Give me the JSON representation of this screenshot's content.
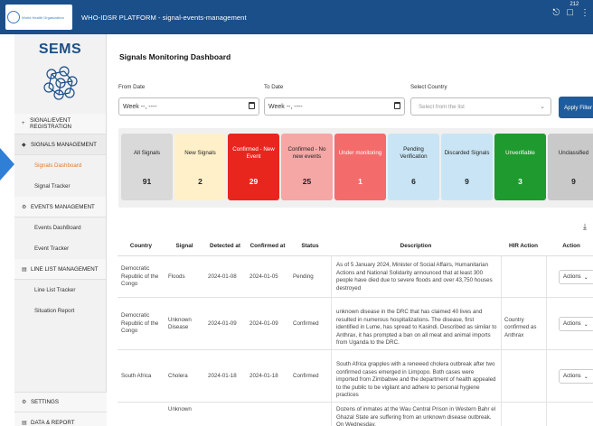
{
  "topbar": {
    "logo_text": "World Health Organization",
    "title": "WHO-IDSR PLATFORM - signal-events-management",
    "notification_count": "212"
  },
  "sidebar": {
    "brand": "SEMS",
    "signal_event_registration": "SIGNAL/EVENT REGISTRATION",
    "signals_management": "SIGNALS MANAGEMENT",
    "signals_dashboard": "Signals Dashboard",
    "signal_tracker": "Signal Tracker",
    "events_management": "EVENTS MANAGEMENT",
    "events_dashboard": "Events DashBoard",
    "event_tracker": "Event Tracker",
    "line_list_management": "LINE LIST MANAGEMENT",
    "line_list_tracker": "Line List Tracker",
    "situation_report": "Situation Report",
    "settings": "SETTINGS",
    "bottom_item": "DATA & REPORT"
  },
  "main": {
    "title": "Signals Monitoring Dashboard",
    "from_date_label": "From Date",
    "to_date_label": "To Date",
    "country_label": "Select Country",
    "from_date_value": "Week --, ----",
    "to_date_value": "Week --, ----",
    "country_placeholder": "Select from the list",
    "apply_label": "Apply Filter"
  },
  "cards": [
    {
      "label": "All Signals",
      "value": "91",
      "bg": "#d9d9d9",
      "fg": "#222222"
    },
    {
      "label": "New Signals",
      "value": "2",
      "bg": "#fff0c9",
      "fg": "#222222"
    },
    {
      "label": "Confirmed - New Event",
      "value": "29",
      "bg": "#e8261e",
      "fg": "#ffffff"
    },
    {
      "label": "Confirmed - No new events",
      "value": "25",
      "bg": "#f4a7a5",
      "fg": "#222222"
    },
    {
      "label": "Under monitoring",
      "value": "1",
      "bg": "#f46b6b",
      "fg": "#ffffff"
    },
    {
      "label": "Pending Verification",
      "value": "6",
      "bg": "#c9e5f5",
      "fg": "#222222"
    },
    {
      "label": "Discarded Signals",
      "value": "9",
      "bg": "#c9e5f5",
      "fg": "#222222"
    },
    {
      "label": "Unverifiable",
      "value": "3",
      "bg": "#1e9a2e",
      "fg": "#ffffff"
    },
    {
      "label": "Unclassified",
      "value": "9",
      "bg": "#c9c9c9",
      "fg": "#222222"
    }
  ],
  "table": {
    "headers": [
      "Country",
      "Signal",
      "Detected at",
      "Confirmed at",
      "Status",
      "Description",
      "HIR Action",
      "Action"
    ],
    "rows": [
      {
        "country": "Democratic Republic of the Congo",
        "signal": "Floods",
        "detected": "2024-01-08",
        "confirmed": "2024-01-05",
        "status": "Pending",
        "description": "As of 5 January 2024, Minister of Social Affairs, Humanitarian Actions and National Solidarity announced that at least 300 people have died due to severe floods and over 43,750 houses destroyed",
        "hir_action": "",
        "action": "Actions"
      },
      {
        "country": "Democratic Republic of the Congo",
        "signal": "Unknown Disease",
        "detected": "2024-01-09",
        "confirmed": "2024-01-09",
        "status": "Confirmed",
        "description": "unknown disease in the DRC that has claimed 40 lives and resulted in numerous hospitalizations. The disease, first identified in Lume, has spread to Kasindi. Described as similar to Anthrax, it has prompted a ban on all meat and animal imports from Uganda to the DRC.",
        "hir_action": "Country confirmed as Anthrax",
        "action": "Actions"
      },
      {
        "country": "South Africa",
        "signal": "Cholera",
        "detected": "2024-01-18",
        "confirmed": "2024-01-18",
        "status": "Confirmed",
        "description": "South Africa grapples with a renewed cholera outbreak after two confirmed cases emerged in Limpopo. Both cases were imported from Zimbabwe and the department of health appealed to the public to be vigilant and adhere to personal hygiene practices",
        "hir_action": "",
        "action": "Actions"
      },
      {
        "country": "",
        "signal": "Unknown",
        "detected": "",
        "confirmed": "",
        "status": "",
        "description": "Dozens of inmates at the Wau Central Prison in Western Bahr el Ghazal State are suffering from an unknown disease outbreak. On Wednesday,",
        "hir_action": "",
        "action": ""
      }
    ]
  }
}
